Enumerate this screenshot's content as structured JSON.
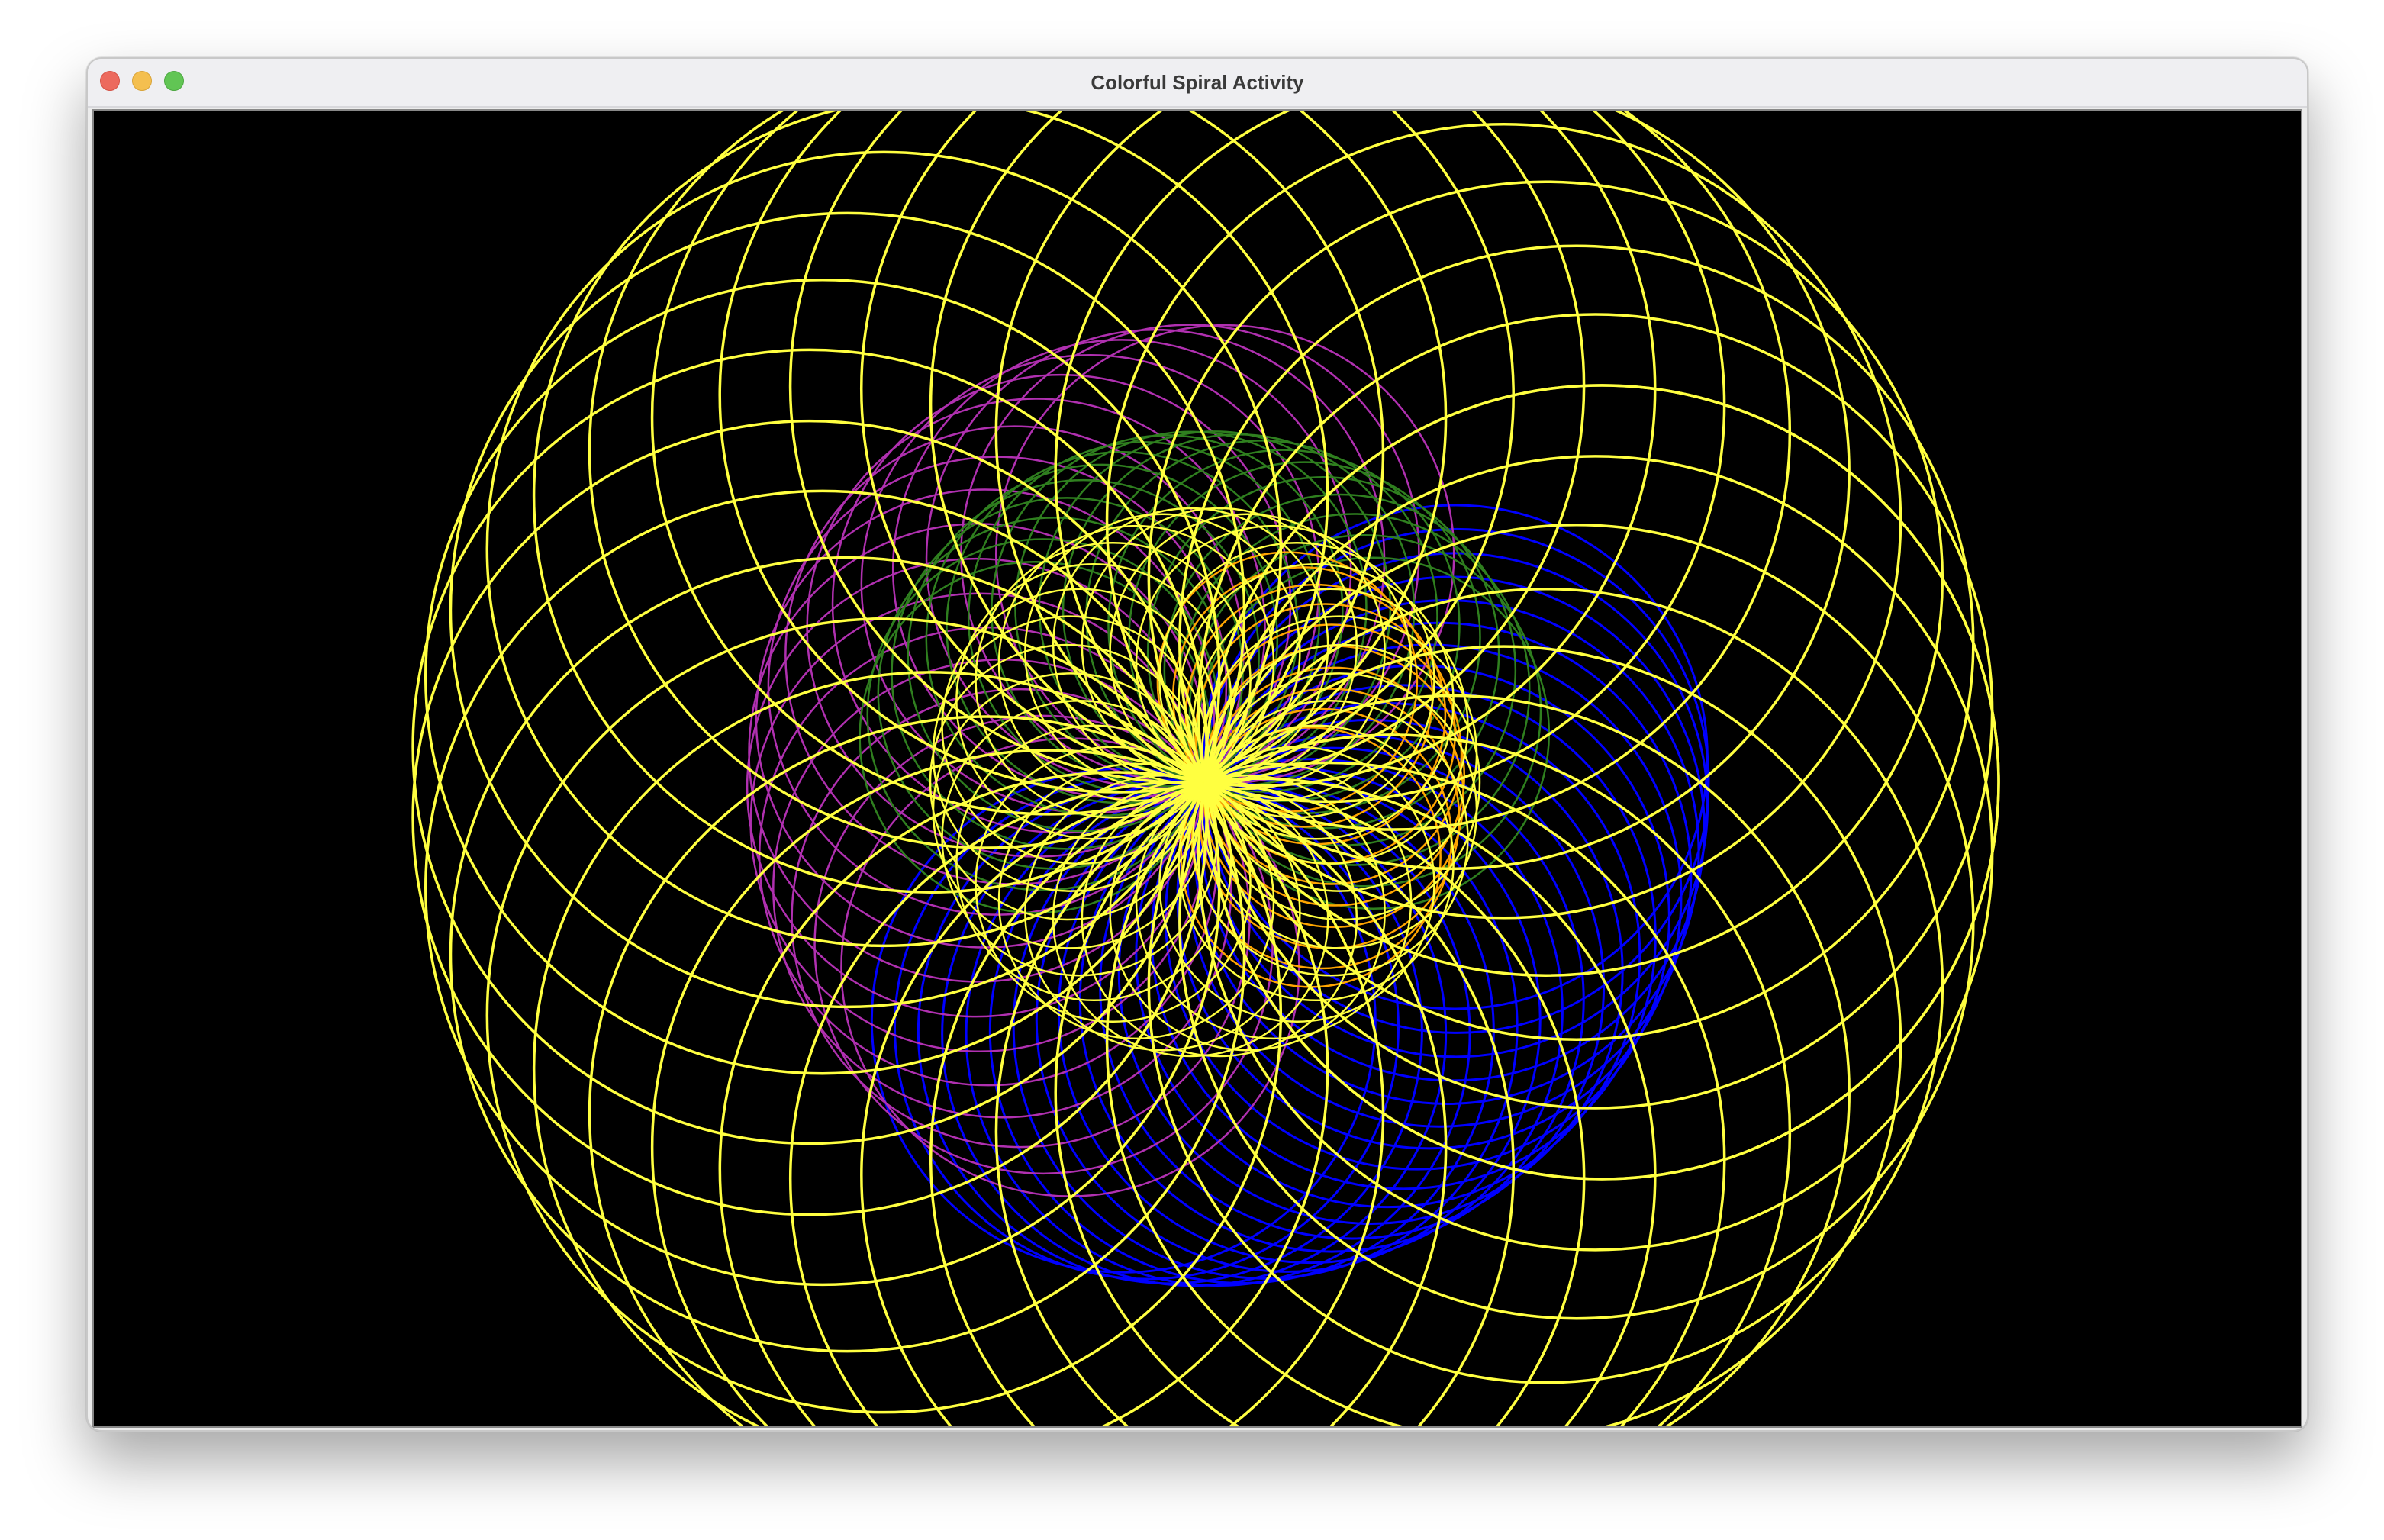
{
  "window": {
    "title": "Colorful Spiral Activity"
  },
  "titlebar": {
    "close_icon": "close-icon",
    "minimize_icon": "minimize-icon",
    "maximize_icon": "maximize-icon"
  },
  "canvas": {
    "background": "#000000",
    "spirals": [
      {
        "color": "#0000ff",
        "label": "blue"
      },
      {
        "color": "#b030b0",
        "label": "purple"
      },
      {
        "color": "#2f7f1f",
        "label": "green"
      },
      {
        "color": "#ffa500",
        "label": "orange"
      },
      {
        "color": "#ffff40",
        "label": "yellow"
      }
    ]
  }
}
